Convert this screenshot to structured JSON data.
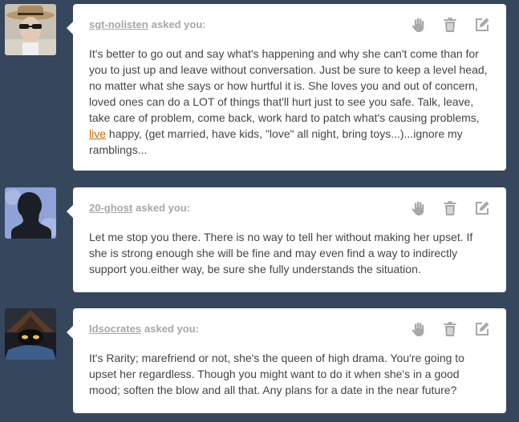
{
  "colors": {
    "background": "#36465d",
    "card": "#ffffff",
    "asker": "#a7a7a7",
    "body": "#444444",
    "link": "#c46b00",
    "icon": "#a8a8a8"
  },
  "posts": [
    {
      "asker": "sgt-nolisten",
      "verb": "asked you:",
      "text_before": "It's better to go out and say what's happening and why she can't come than for you to just up and leave without conversation. Just be sure to keep a level head, no matter what she says or how hurtful it is. She loves you and out of concern, loved ones can do a LOT of things that'll hurt just to see you safe. Talk, leave, take care of problem, come back, work hard to patch what's causing problems, ",
      "link": "live",
      "text_after": " happy, (get married, have kids, \"love\" all night, bring toys...)...ignore my ramblings..."
    },
    {
      "asker": "20-ghost",
      "verb": "asked you:",
      "text": "Let me stop you there. There is no way to tell her without making her upset. If she is strong enough she will be fine and may even find a way to indirectly support you.either way, be sure she fully understands the situation."
    },
    {
      "asker": "Idsocrates",
      "verb": "asked you:",
      "text": "It's Rarity; marefriend or not, she's the queen of high drama. You're going to upset her regardless. Though you might want to do it when she's in a good mood; soften the blow and all that. Any plans for a date in the near future?"
    }
  ],
  "icons": [
    "hand-icon",
    "trash-icon",
    "edit-icon"
  ]
}
